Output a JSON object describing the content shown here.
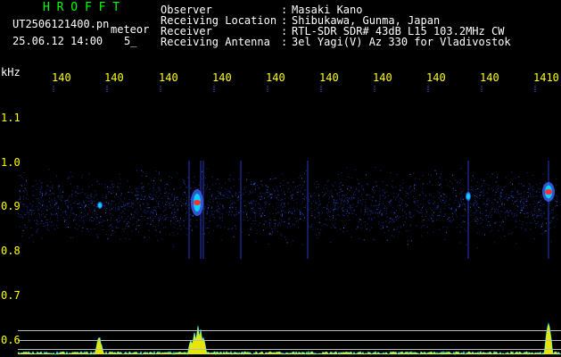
{
  "header": {
    "brand": "H R O F F T",
    "filename": "UT2506121400.pn",
    "app_tag": "meteor",
    "datetime": "25.06.12 14:00",
    "count": "5_",
    "info": [
      {
        "label": "Observer",
        "sep": ":",
        "value": "Masaki Kano"
      },
      {
        "label": "Receiving Location",
        "sep": ":",
        "value": "Shibukawa, Gunma, Japan"
      },
      {
        "label": "Receiver",
        "sep": ":",
        "value": "RTL-SDR SDR# 43dB L15 103.2MHz CW"
      },
      {
        "label": "Receiving Antenna",
        "sep": ":",
        "value": "3el Yagi(V) Az 330 for Vladivostok"
      }
    ]
  },
  "axes": {
    "y_unit": "kHz",
    "y_ticks": [
      "1.1",
      "1.0",
      "0.9",
      "0.8",
      "0.7",
      "0.6"
    ],
    "x_ticks": [
      "140",
      "140",
      "140",
      "140",
      "140",
      "140",
      "140",
      "140",
      "140",
      "1410"
    ]
  },
  "colors": {
    "background": "#000000",
    "text": "#ffffff",
    "brand": "#00ff00",
    "axis_labels": "#ffff00",
    "noise_dark": "#1a2a8a",
    "noise_bright": "#3a6aff",
    "meteor_core": "#ff3030",
    "meteor_mid": "#00e0ff",
    "profile": "#ffff00",
    "baseline": "#00c8ff"
  }
}
